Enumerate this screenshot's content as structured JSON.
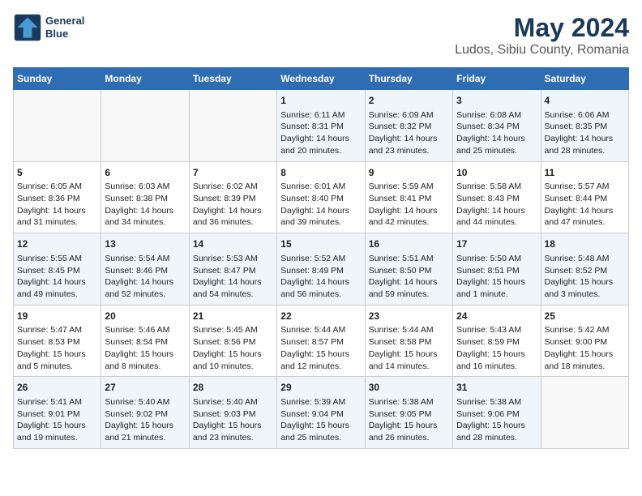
{
  "header": {
    "logo_line1": "General",
    "logo_line2": "Blue",
    "title": "May 2024",
    "subtitle": "Ludos, Sibiu County, Romania"
  },
  "days_of_week": [
    "Sunday",
    "Monday",
    "Tuesday",
    "Wednesday",
    "Thursday",
    "Friday",
    "Saturday"
  ],
  "weeks": [
    {
      "cells": [
        {
          "day": "",
          "content": ""
        },
        {
          "day": "",
          "content": ""
        },
        {
          "day": "",
          "content": ""
        },
        {
          "day": "1",
          "content": "Sunrise: 6:11 AM\nSunset: 8:31 PM\nDaylight: 14 hours\nand 20 minutes."
        },
        {
          "day": "2",
          "content": "Sunrise: 6:09 AM\nSunset: 8:32 PM\nDaylight: 14 hours\nand 23 minutes."
        },
        {
          "day": "3",
          "content": "Sunrise: 6:08 AM\nSunset: 8:34 PM\nDaylight: 14 hours\nand 25 minutes."
        },
        {
          "day": "4",
          "content": "Sunrise: 6:06 AM\nSunset: 8:35 PM\nDaylight: 14 hours\nand 28 minutes."
        }
      ]
    },
    {
      "cells": [
        {
          "day": "5",
          "content": "Sunrise: 6:05 AM\nSunset: 8:36 PM\nDaylight: 14 hours\nand 31 minutes."
        },
        {
          "day": "6",
          "content": "Sunrise: 6:03 AM\nSunset: 8:38 PM\nDaylight: 14 hours\nand 34 minutes."
        },
        {
          "day": "7",
          "content": "Sunrise: 6:02 AM\nSunset: 8:39 PM\nDaylight: 14 hours\nand 36 minutes."
        },
        {
          "day": "8",
          "content": "Sunrise: 6:01 AM\nSunset: 8:40 PM\nDaylight: 14 hours\nand 39 minutes."
        },
        {
          "day": "9",
          "content": "Sunrise: 5:59 AM\nSunset: 8:41 PM\nDaylight: 14 hours\nand 42 minutes."
        },
        {
          "day": "10",
          "content": "Sunrise: 5:58 AM\nSunset: 8:43 PM\nDaylight: 14 hours\nand 44 minutes."
        },
        {
          "day": "11",
          "content": "Sunrise: 5:57 AM\nSunset: 8:44 PM\nDaylight: 14 hours\nand 47 minutes."
        }
      ]
    },
    {
      "cells": [
        {
          "day": "12",
          "content": "Sunrise: 5:55 AM\nSunset: 8:45 PM\nDaylight: 14 hours\nand 49 minutes."
        },
        {
          "day": "13",
          "content": "Sunrise: 5:54 AM\nSunset: 8:46 PM\nDaylight: 14 hours\nand 52 minutes."
        },
        {
          "day": "14",
          "content": "Sunrise: 5:53 AM\nSunset: 8:47 PM\nDaylight: 14 hours\nand 54 minutes."
        },
        {
          "day": "15",
          "content": "Sunrise: 5:52 AM\nSunset: 8:49 PM\nDaylight: 14 hours\nand 56 minutes."
        },
        {
          "day": "16",
          "content": "Sunrise: 5:51 AM\nSunset: 8:50 PM\nDaylight: 14 hours\nand 59 minutes."
        },
        {
          "day": "17",
          "content": "Sunrise: 5:50 AM\nSunset: 8:51 PM\nDaylight: 15 hours\nand 1 minute."
        },
        {
          "day": "18",
          "content": "Sunrise: 5:48 AM\nSunset: 8:52 PM\nDaylight: 15 hours\nand 3 minutes."
        }
      ]
    },
    {
      "cells": [
        {
          "day": "19",
          "content": "Sunrise: 5:47 AM\nSunset: 8:53 PM\nDaylight: 15 hours\nand 5 minutes."
        },
        {
          "day": "20",
          "content": "Sunrise: 5:46 AM\nSunset: 8:54 PM\nDaylight: 15 hours\nand 8 minutes."
        },
        {
          "day": "21",
          "content": "Sunrise: 5:45 AM\nSunset: 8:56 PM\nDaylight: 15 hours\nand 10 minutes."
        },
        {
          "day": "22",
          "content": "Sunrise: 5:44 AM\nSunset: 8:57 PM\nDaylight: 15 hours\nand 12 minutes."
        },
        {
          "day": "23",
          "content": "Sunrise: 5:44 AM\nSunset: 8:58 PM\nDaylight: 15 hours\nand 14 minutes."
        },
        {
          "day": "24",
          "content": "Sunrise: 5:43 AM\nSunset: 8:59 PM\nDaylight: 15 hours\nand 16 minutes."
        },
        {
          "day": "25",
          "content": "Sunrise: 5:42 AM\nSunset: 9:00 PM\nDaylight: 15 hours\nand 18 minutes."
        }
      ]
    },
    {
      "cells": [
        {
          "day": "26",
          "content": "Sunrise: 5:41 AM\nSunset: 9:01 PM\nDaylight: 15 hours\nand 19 minutes."
        },
        {
          "day": "27",
          "content": "Sunrise: 5:40 AM\nSunset: 9:02 PM\nDaylight: 15 hours\nand 21 minutes."
        },
        {
          "day": "28",
          "content": "Sunrise: 5:40 AM\nSunset: 9:03 PM\nDaylight: 15 hours\nand 23 minutes."
        },
        {
          "day": "29",
          "content": "Sunrise: 5:39 AM\nSunset: 9:04 PM\nDaylight: 15 hours\nand 25 minutes."
        },
        {
          "day": "30",
          "content": "Sunrise: 5:38 AM\nSunset: 9:05 PM\nDaylight: 15 hours\nand 26 minutes."
        },
        {
          "day": "31",
          "content": "Sunrise: 5:38 AM\nSunset: 9:06 PM\nDaylight: 15 hours\nand 28 minutes."
        },
        {
          "day": "",
          "content": ""
        }
      ]
    }
  ]
}
